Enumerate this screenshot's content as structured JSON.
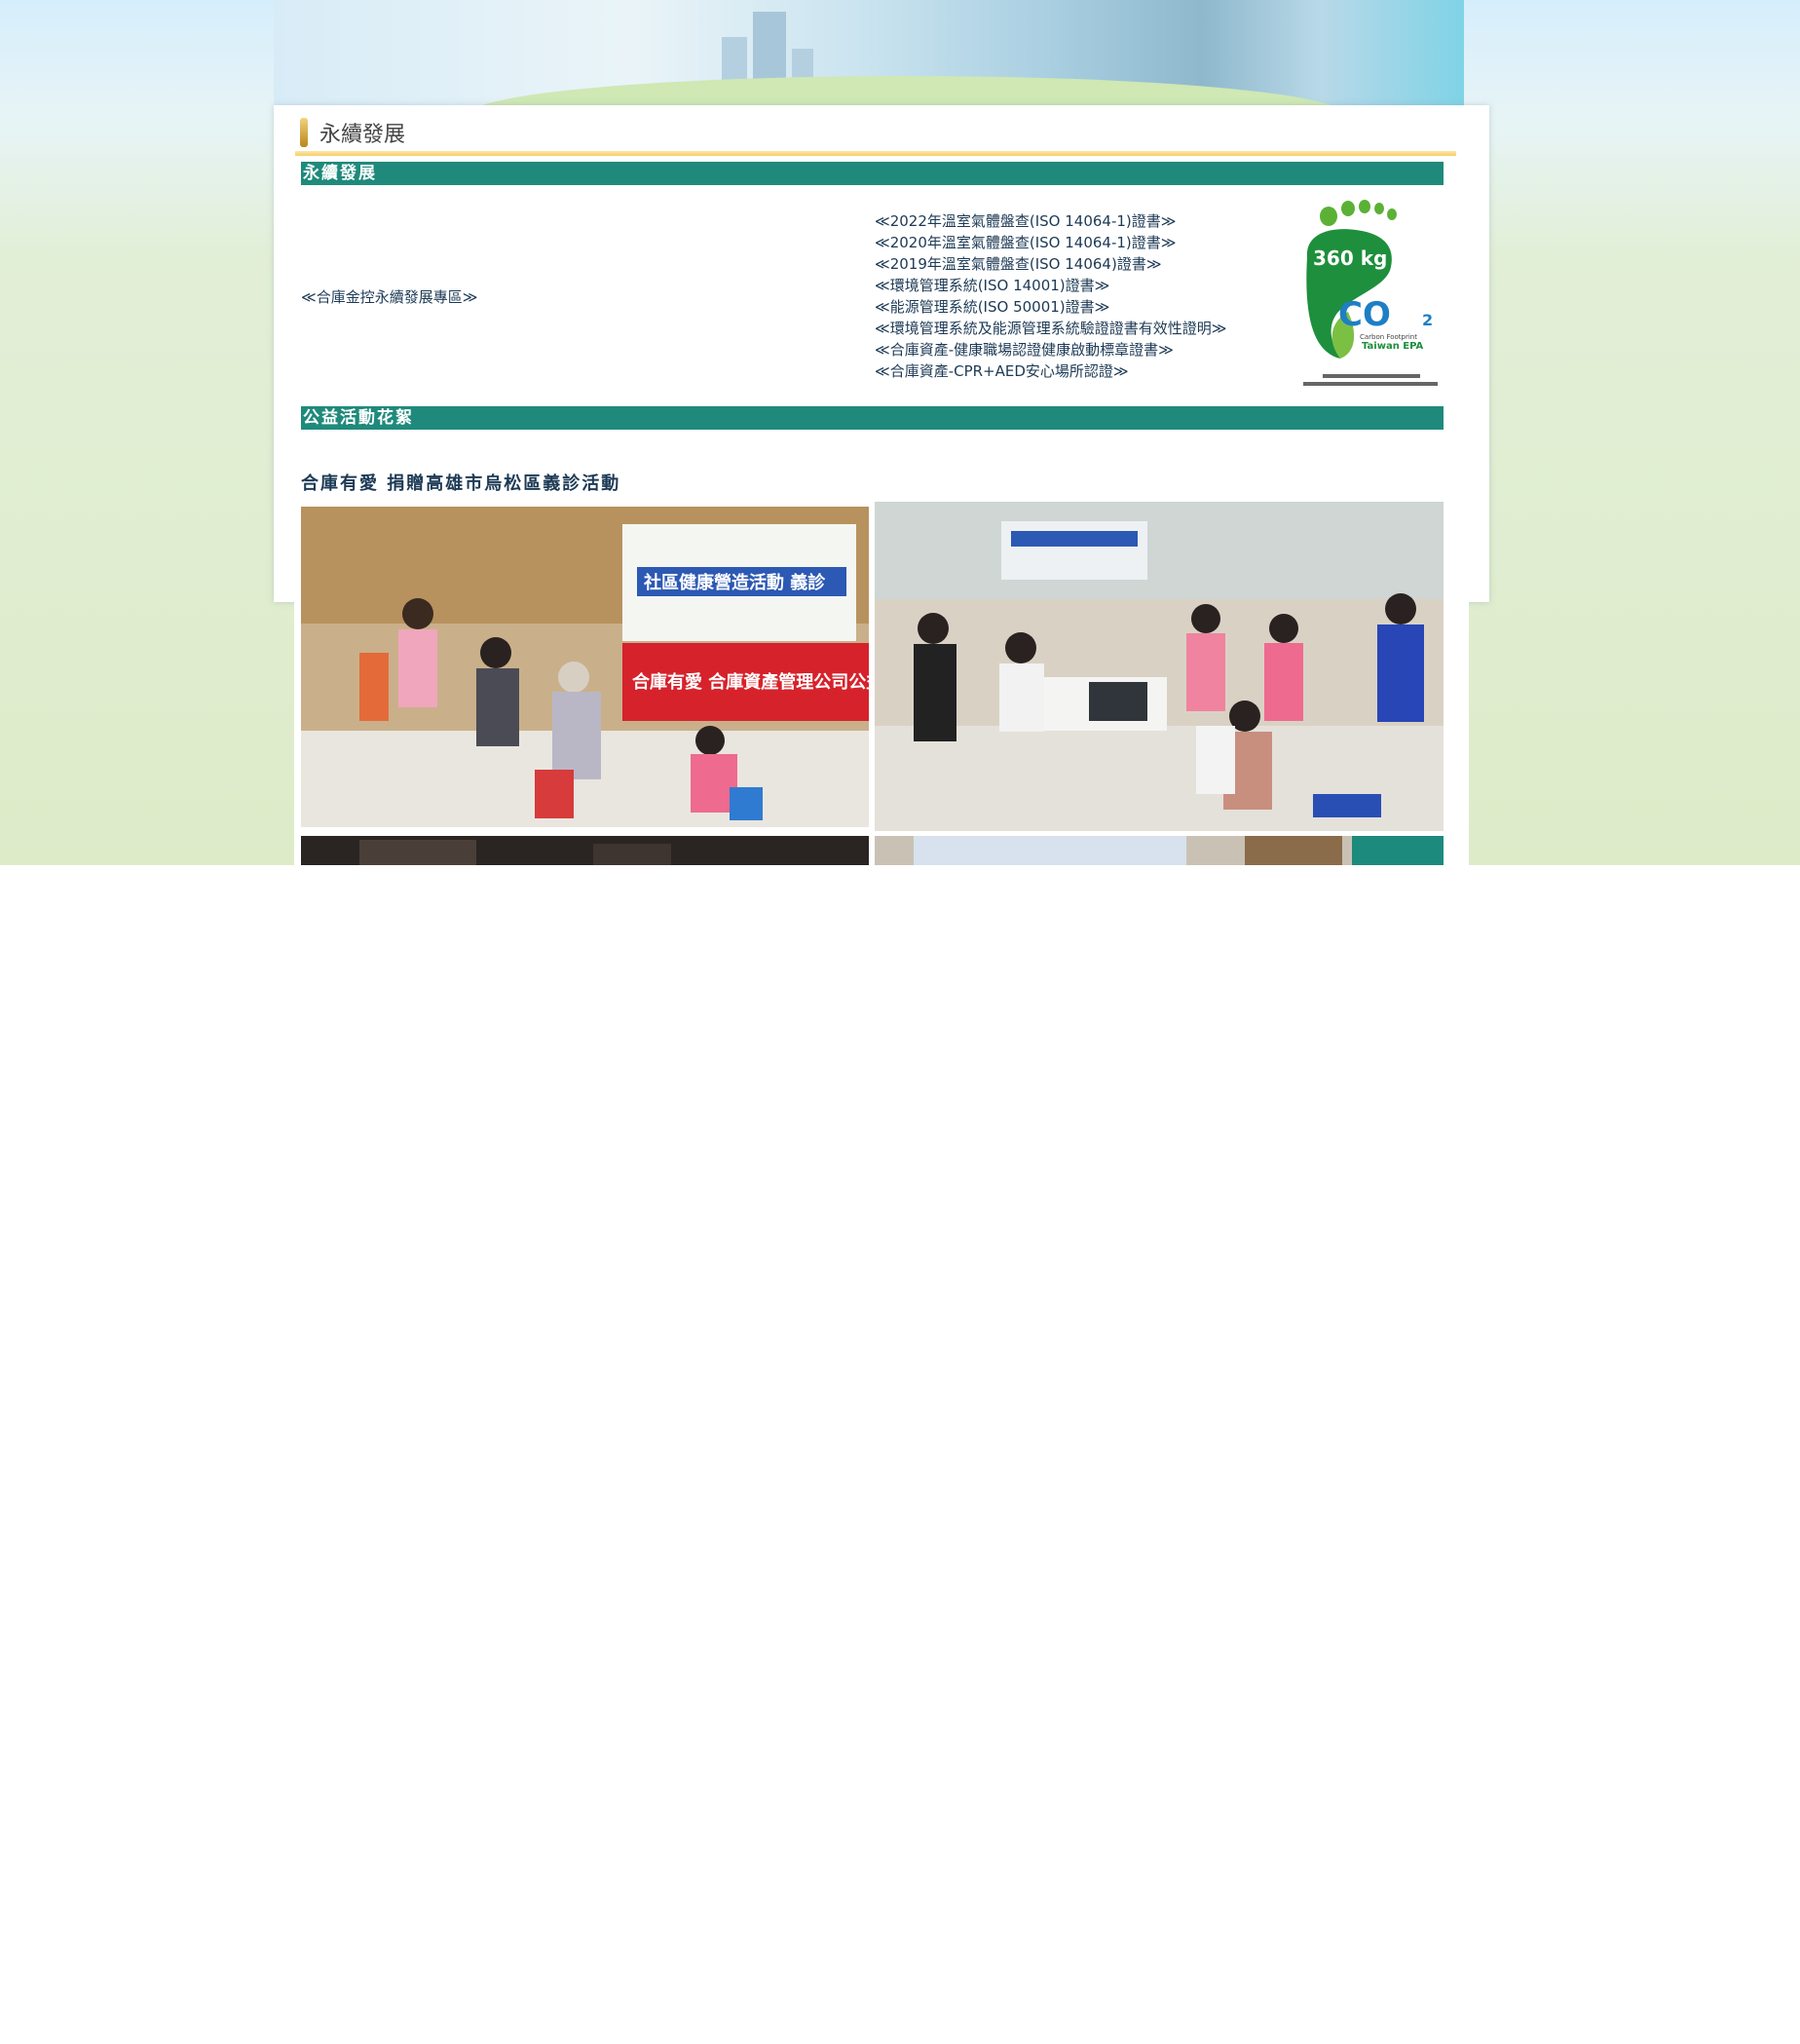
{
  "page": {
    "title": "永續發展"
  },
  "sections": {
    "sustainability": "永續發展",
    "charity": "公益活動花絮"
  },
  "links": {
    "zone": "≪合庫金控永續發展專區≫",
    "certs": [
      "≪2022年溫室氣體盤查(ISO 14064-1)證書≫",
      "≪2020年溫室氣體盤查(ISO 14064-1)證書≫",
      "≪2019年溫室氣體盤查(ISO 14064)證書≫",
      "≪環境管理系統(ISO 14001)證書≫",
      "≪能源管理系統(ISO 50001)證書≫",
      "≪環境管理系統及能源管理系統驗證證書有效性證明≫",
      "≪合庫資產-健康職場認證健康啟動標章證書≫",
      "≪合庫資產-CPR+AED安心場所認證≫"
    ]
  },
  "carbon_label": {
    "amount": "360 kg",
    "co2": "CO",
    "sub": "2",
    "line1": "Carbon Footprint",
    "line2": "Taiwan EPA"
  },
  "activity": {
    "title": "合庫有愛 捐贈高雄市烏松區義診活動",
    "photo_banner_1": "社區健康營造活動 義診",
    "photo_banner_2": "合庫有愛 合庫資產管理公司公益活"
  },
  "colors": {
    "teal": "#1f8a7c",
    "gold": "#f7cf69",
    "link": "#1d3a55",
    "foot_green": "#1e8f3c",
    "co2_blue": "#1e7fc4"
  }
}
